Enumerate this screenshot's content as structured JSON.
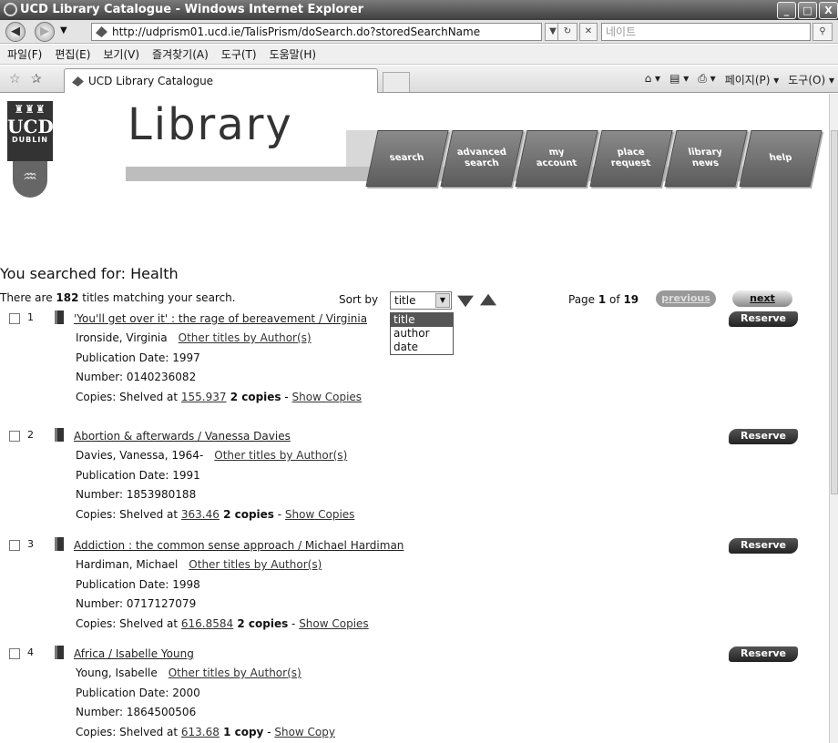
{
  "window": {
    "title": "UCD Library Catalogue - Windows Internet Explorer",
    "url": "http://udprism01.ucd.ie/TalisPrism/doSearch.do?storedSearchName",
    "search_placeholder": "네이트",
    "minimize": "_",
    "maximize": "□",
    "close": "X"
  },
  "menu": [
    "파일(F)",
    "편집(E)",
    "보기(V)",
    "즐겨찾기(A)",
    "도구(T)",
    "도움말(H)"
  ],
  "tab": {
    "label": "UCD Library Catalogue"
  },
  "commandbar": {
    "page": "페이지(P) ▾",
    "tools": "도구(O) ▾"
  },
  "header": {
    "brand": "Library",
    "logo": {
      "ucd": "UCD",
      "dublin": "DUBLIN"
    },
    "nav": [
      {
        "line1": "search",
        "line2": ""
      },
      {
        "line1": "advanced",
        "line2": "search"
      },
      {
        "line1": "my",
        "line2": "account"
      },
      {
        "line1": "place",
        "line2": "request"
      },
      {
        "line1": "library",
        "line2": "news"
      },
      {
        "line1": "help",
        "line2": ""
      }
    ]
  },
  "search": {
    "searched_for": "You searched for: Health",
    "count_prefix": "There are ",
    "count": "182",
    "count_suffix": " titles matching your search.",
    "sort_label": "Sort by",
    "sort_value": "title",
    "sort_options": [
      "title",
      "author",
      "date"
    ],
    "page_prefix": "Page ",
    "page_current": "1",
    "page_of": " of ",
    "page_total": "19",
    "previous": "previous",
    "next": "next"
  },
  "results": [
    {
      "num": "1",
      "title": "'You'll get over it' : the rage of bereavement / Virginia",
      "author": "Ironside, Virginia",
      "other": "Other titles by Author(s)",
      "pubdate": "Publication Date: 1997",
      "number": "Number: 0140236082",
      "copies_prefix": "Copies:  Shelved at ",
      "shelf": "155.937",
      "copies_count": " 2 copies",
      "show": "Show Copies",
      "reserve": "Reserve"
    },
    {
      "num": "2",
      "title": "Abortion & afterwards / Vanessa Davies",
      "author": "Davies, Vanessa, 1964-",
      "other": "Other titles by Author(s)",
      "pubdate": "Publication Date: 1991",
      "number": "Number: 1853980188",
      "copies_prefix": "Copies:  Shelved at ",
      "shelf": "363.46",
      "copies_count": " 2 copies",
      "show": "Show Copies",
      "reserve": "Reserve"
    },
    {
      "num": "3",
      "title": "Addiction : the common sense approach / Michael Hardiman",
      "author": "Hardiman, Michael",
      "other": "Other titles by Author(s)",
      "pubdate": "Publication Date: 1998",
      "number": "Number: 0717127079",
      "copies_prefix": "Copies:  Shelved at ",
      "shelf": "616.8584",
      "copies_count": " 2 copies",
      "show": "Show Copies",
      "reserve": "Reserve"
    },
    {
      "num": "4",
      "title": "Africa / Isabelle Young",
      "author": "Young, Isabelle",
      "other": "Other titles by Author(s)",
      "pubdate": "Publication Date: 2000",
      "number": "Number: 1864500506",
      "copies_prefix": "Copies:  Shelved at ",
      "shelf": "613.68",
      "copies_count": " 1 copy",
      "show": "Show Copy",
      "reserve": "Reserve"
    }
  ]
}
